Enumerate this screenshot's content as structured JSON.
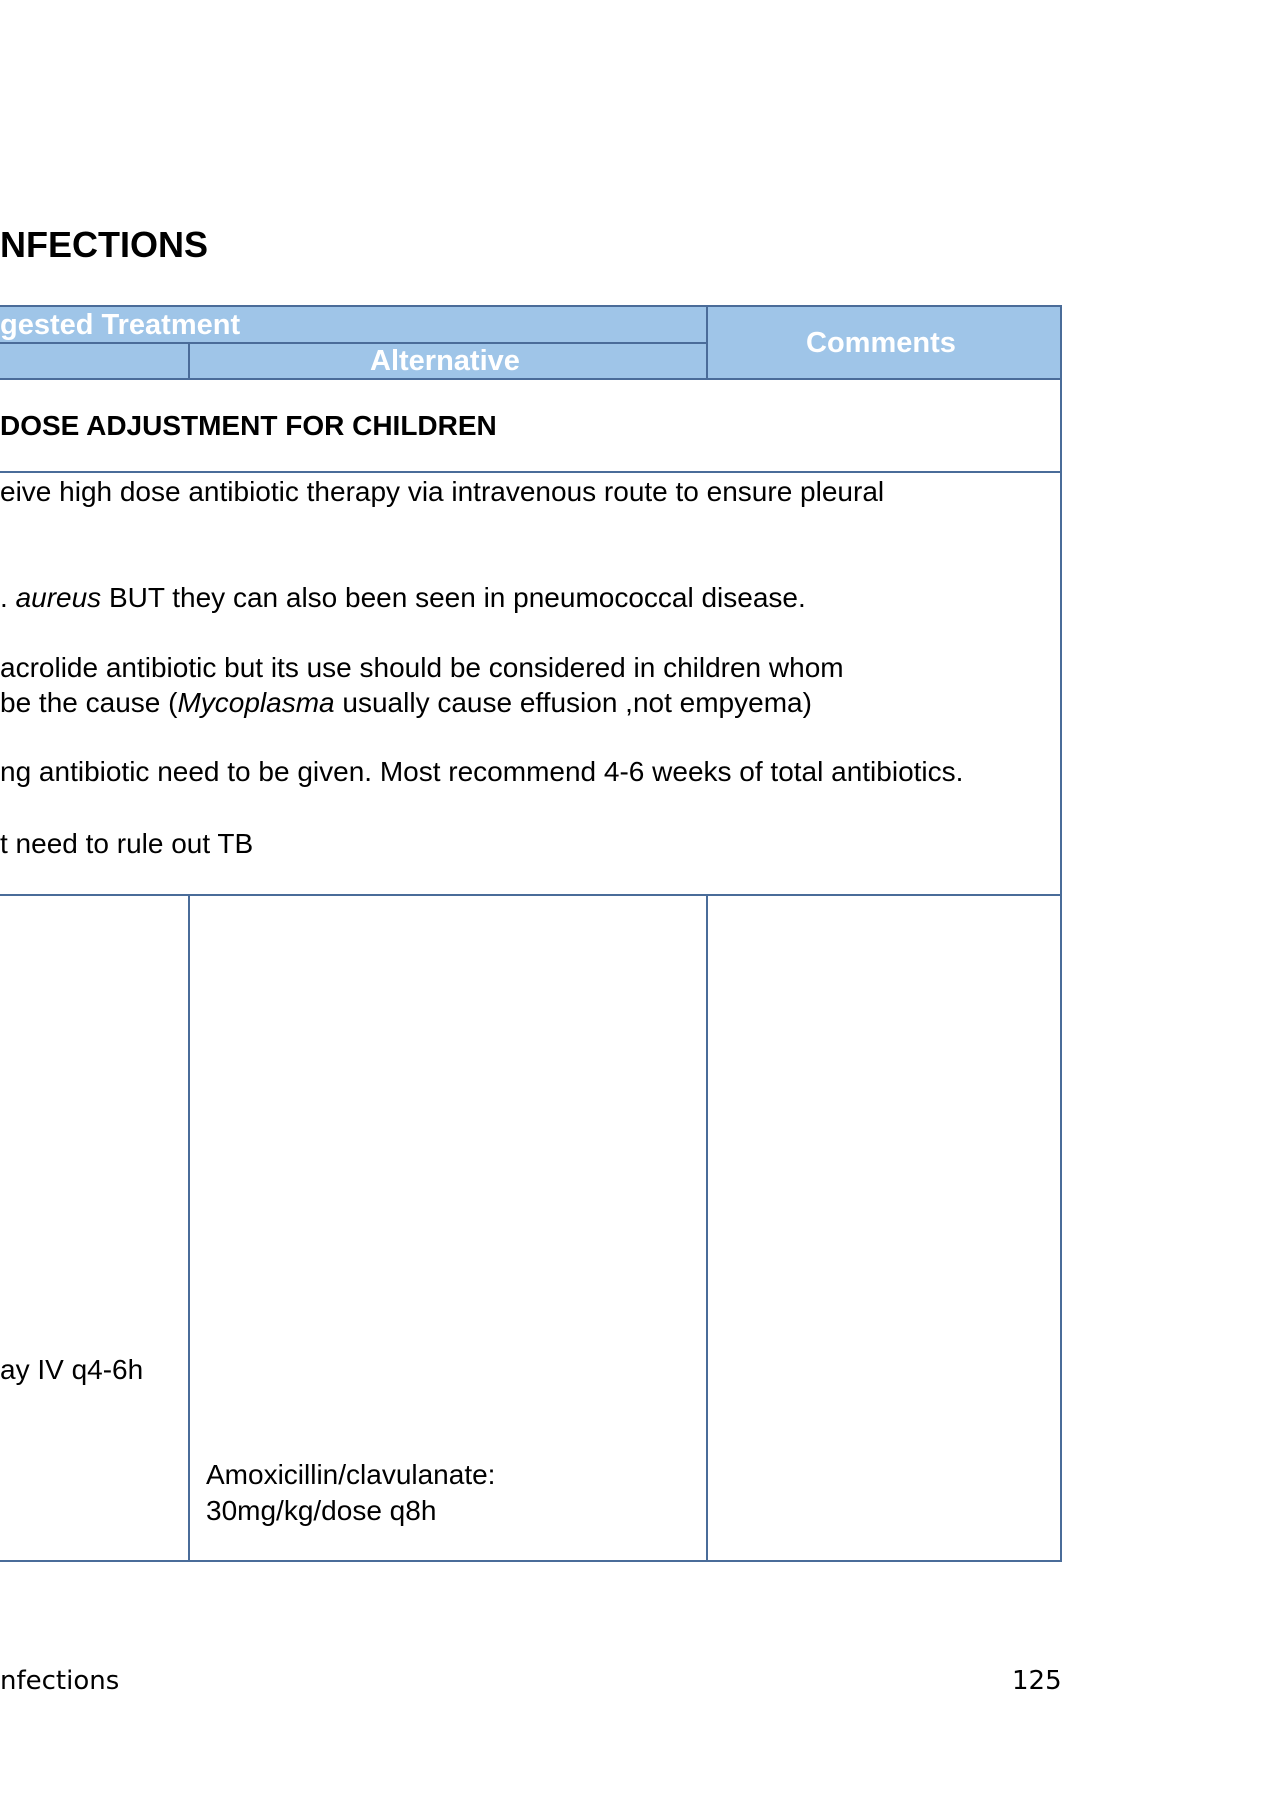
{
  "heading": "NFECTIONS",
  "table": {
    "header": {
      "suggested_treatment": "gested Treatment",
      "alternative": "Alternative",
      "comments": "Comments"
    },
    "section_title": "DOSE ADJUSTMENT FOR CHILDREN",
    "notes": {
      "n1": "eive high dose antibiotic therapy via intravenous route to ensure pleural",
      "n2_pre": ". ",
      "n2_italic": "aureus",
      "n2_post": "  BUT they can also been seen in pneumococcal disease.",
      "n3": "acrolide antibiotic but its use should be considered in children whom",
      "n4_pre": " be the cause (",
      "n4_italic": "Mycoplasma",
      "n4_post": " usually cause effusion ,not  empyema)",
      "n5": "ng antibiotic need to be given. Most recommend 4-6 weeks of total antibiotics.",
      "n6": "t need to rule out TB"
    },
    "row": {
      "col1_text": "ay IV q4-6h",
      "col2_line1": "Amoxicillin/clavulanate:",
      "col2_line2": "30mg/kg/dose q8h"
    }
  },
  "footer": {
    "left": "nfections",
    "page_number": "125"
  }
}
